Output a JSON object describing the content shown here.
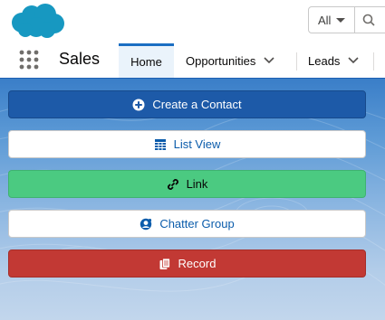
{
  "header": {
    "logo_name": "salesforce-cloud-logo",
    "search": {
      "scope_label": "All"
    }
  },
  "nav": {
    "app_name": "Sales",
    "tabs": [
      {
        "label": "Home",
        "active": true
      },
      {
        "label": "Opportunities",
        "has_menu": true
      },
      {
        "label": "Leads",
        "has_menu": true
      }
    ]
  },
  "actions": [
    {
      "label": "Create a Contact",
      "icon": "plus-circle-icon"
    },
    {
      "label": "List View",
      "icon": "table-icon"
    },
    {
      "label": "Link",
      "icon": "link-icon"
    },
    {
      "label": "Chatter Group",
      "icon": "chatter-group-icon"
    },
    {
      "label": "Record",
      "icon": "record-icon"
    }
  ],
  "colors": {
    "brand_blue": "#1d5aa8",
    "link_green": "#4bca81",
    "record_red": "#c23934",
    "salesforce_cloud": "#1798c1"
  }
}
